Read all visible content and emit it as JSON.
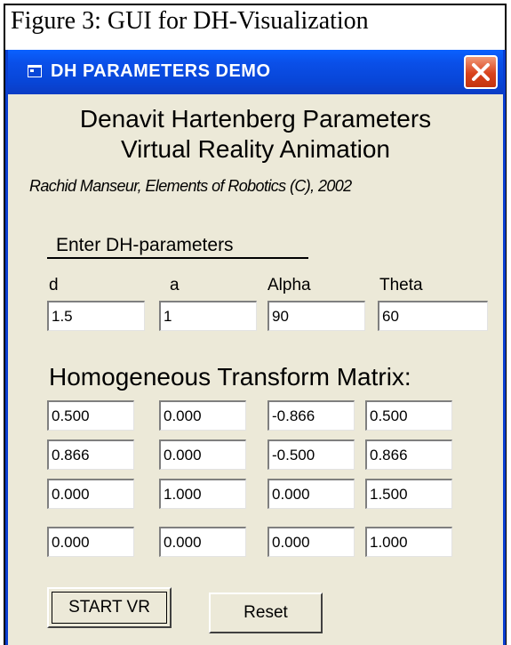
{
  "caption": "Figure 3:  GUI for DH-Visualization",
  "window": {
    "title": "DH PARAMETERS DEMO",
    "heading_line1": "Denavit Hartenberg Parameters",
    "heading_line2": "Virtual Reality Animation",
    "credit": "Rachid Manseur, Elements of Robotics (C), 2002"
  },
  "params": {
    "section_label": "Enter DH-parameters",
    "labels": [
      "d",
      "a",
      "Alpha",
      "Theta"
    ],
    "values": [
      "1.5",
      "1",
      "90",
      "60"
    ]
  },
  "matrix": {
    "title": "Homogeneous Transform Matrix:",
    "rows": [
      [
        "0.500",
        "0.000",
        "-0.866",
        "0.500"
      ],
      [
        "0.866",
        "0.000",
        "-0.500",
        "0.866"
      ],
      [
        "0.000",
        "1.000",
        "0.000",
        "1.500"
      ],
      [
        "0.000",
        "0.000",
        "0.000",
        "1.000"
      ]
    ]
  },
  "buttons": {
    "start": "START VR",
    "reset": "Reset"
  },
  "colors": {
    "titlebar": "#0a4fe8",
    "window_bg": "#ece9d8",
    "close": "#d9421c"
  },
  "icons": {
    "app": "app-window-icon",
    "close": "close-icon"
  }
}
